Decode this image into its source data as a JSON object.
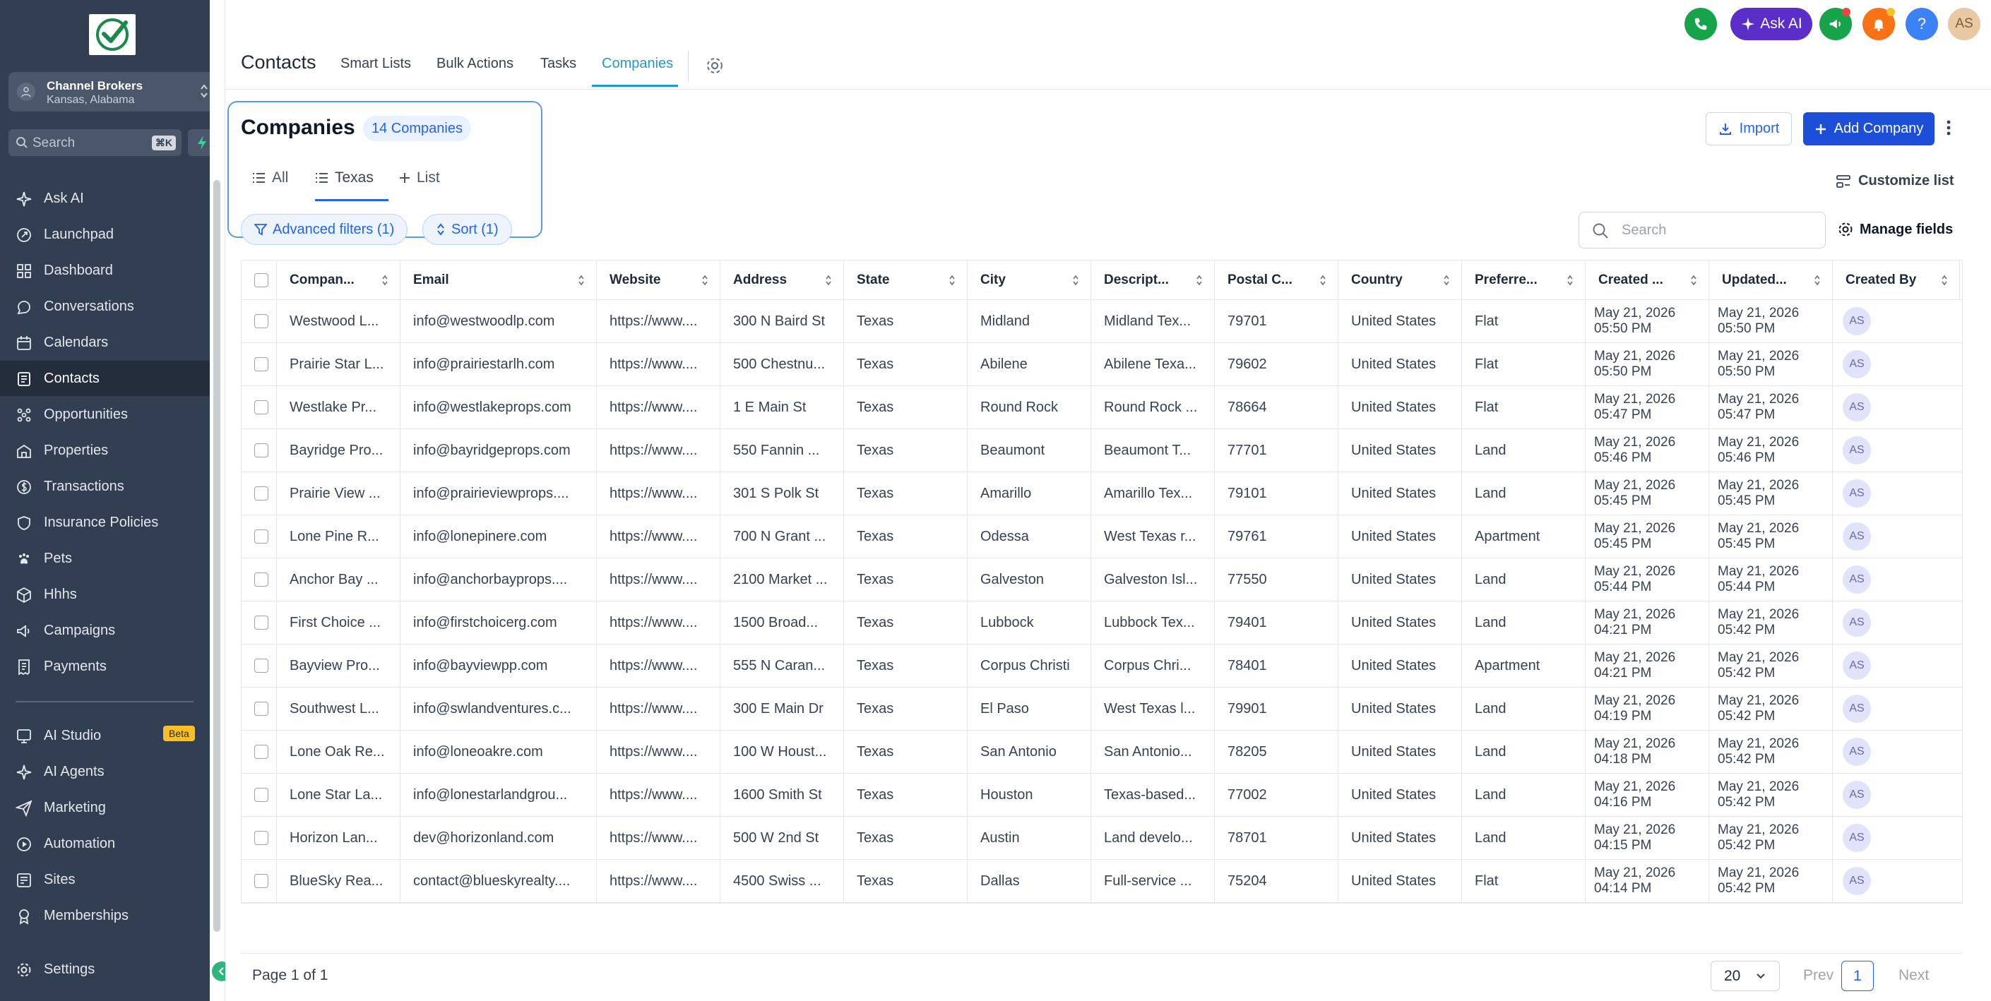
{
  "sidebar": {
    "account": {
      "name": "Channel Brokers",
      "location": "Kansas, Alabama"
    },
    "search": {
      "placeholder": "Search",
      "shortcut": "⌘K"
    },
    "items": [
      {
        "label": "Ask AI",
        "icon": "sparkle-icon"
      },
      {
        "label": "Launchpad",
        "icon": "rocket-icon"
      },
      {
        "label": "Dashboard",
        "icon": "grid-icon"
      },
      {
        "label": "Conversations",
        "icon": "chat-icon"
      },
      {
        "label": "Calendars",
        "icon": "calendar-icon"
      },
      {
        "label": "Contacts",
        "icon": "contacts-icon",
        "active": true
      },
      {
        "label": "Opportunities",
        "icon": "opportunities-icon"
      },
      {
        "label": "Properties",
        "icon": "building-icon"
      },
      {
        "label": "Transactions",
        "icon": "dollar-icon"
      },
      {
        "label": "Insurance Policies",
        "icon": "shield-icon"
      },
      {
        "label": "Pets",
        "icon": "paw-icon"
      },
      {
        "label": "Hhhs",
        "icon": "cube-icon"
      },
      {
        "label": "Campaigns",
        "icon": "megaphone-icon"
      },
      {
        "label": "Payments",
        "icon": "receipt-icon"
      }
    ],
    "items2": [
      {
        "label": "AI Studio",
        "icon": "studio-icon",
        "badge": "Beta"
      },
      {
        "label": "AI Agents",
        "icon": "sparkle-icon"
      },
      {
        "label": "Marketing",
        "icon": "send-icon"
      },
      {
        "label": "Automation",
        "icon": "automation-icon"
      },
      {
        "label": "Sites",
        "icon": "sites-icon"
      },
      {
        "label": "Memberships",
        "icon": "award-icon"
      }
    ],
    "settings": "Settings"
  },
  "topbar": {
    "title": "Contacts",
    "links": [
      "Smart Lists",
      "Bulk Actions",
      "Tasks",
      "Companies"
    ],
    "active": "Companies",
    "ask_ai": "Ask AI",
    "user_initials": "AS",
    "help": "?"
  },
  "page": {
    "heading": "Companies",
    "count_badge": "14 Companies",
    "views": [
      "All",
      "Texas",
      "List"
    ],
    "filters": {
      "advanced": "Advanced filters (1)",
      "sort": "Sort (1)"
    },
    "import": "Import",
    "add": "Add Company",
    "customize": "Customize list",
    "search_placeholder": "Search",
    "manage_fields": "Manage fields"
  },
  "table": {
    "headers": [
      "Compan...",
      "Email",
      "Website",
      "Address",
      "State",
      "City",
      "Descript...",
      "Postal C...",
      "Country",
      "Preferre...",
      "Created ...",
      "Updated...",
      "Created By"
    ],
    "rows": [
      [
        "Westwood L...",
        "info@westwoodlp.com",
        "https://www....",
        "300 N Baird St",
        "Texas",
        "Midland",
        "Midland Tex...",
        "79701",
        "United States",
        "Flat",
        [
          "May 21, 2026",
          "05:50 PM"
        ],
        [
          "May 21, 2026",
          "05:50 PM"
        ],
        "AS"
      ],
      [
        "Prairie Star L...",
        "info@prairiestarlh.com",
        "https://www....",
        "500 Chestnu...",
        "Texas",
        "Abilene",
        "Abilene Texa...",
        "79602",
        "United States",
        "Flat",
        [
          "May 21, 2026",
          "05:50 PM"
        ],
        [
          "May 21, 2026",
          "05:50 PM"
        ],
        "AS"
      ],
      [
        "Westlake Pr...",
        "info@westlakeprops.com",
        "https://www....",
        "1 E Main St",
        "Texas",
        "Round Rock",
        "Round Rock ...",
        "78664",
        "United States",
        "Flat",
        [
          "May 21, 2026",
          "05:47 PM"
        ],
        [
          "May 21, 2026",
          "05:47 PM"
        ],
        "AS"
      ],
      [
        "Bayridge Pro...",
        "info@bayridgeprops.com",
        "https://www....",
        "550 Fannin ...",
        "Texas",
        "Beaumont",
        "Beaumont T...",
        "77701",
        "United States",
        "Land",
        [
          "May 21, 2026",
          "05:46 PM"
        ],
        [
          "May 21, 2026",
          "05:46 PM"
        ],
        "AS"
      ],
      [
        "Prairie View ...",
        "info@prairieviewprops....",
        "https://www....",
        "301 S Polk St",
        "Texas",
        "Amarillo",
        "Amarillo Tex...",
        "79101",
        "United States",
        "Land",
        [
          "May 21, 2026",
          "05:45 PM"
        ],
        [
          "May 21, 2026",
          "05:45 PM"
        ],
        "AS"
      ],
      [
        "Lone Pine R...",
        "info@lonepinere.com",
        "https://www....",
        "700 N Grant ...",
        "Texas",
        "Odessa",
        "West Texas r...",
        "79761",
        "United States",
        "Apartment",
        [
          "May 21, 2026",
          "05:45 PM"
        ],
        [
          "May 21, 2026",
          "05:45 PM"
        ],
        "AS"
      ],
      [
        "Anchor Bay ...",
        "info@anchorbayprops....",
        "https://www....",
        "2100 Market ...",
        "Texas",
        "Galveston",
        "Galveston Isl...",
        "77550",
        "United States",
        "Land",
        [
          "May 21, 2026",
          "05:44 PM"
        ],
        [
          "May 21, 2026",
          "05:44 PM"
        ],
        "AS"
      ],
      [
        "First Choice ...",
        "info@firstchoicerg.com",
        "https://www....",
        "1500 Broad...",
        "Texas",
        "Lubbock",
        "Lubbock Tex...",
        "79401",
        "United States",
        "Land",
        [
          "May 21, 2026",
          "04:21 PM"
        ],
        [
          "May 21, 2026",
          "05:42 PM"
        ],
        "AS"
      ],
      [
        "Bayview Pro...",
        "info@bayviewpp.com",
        "https://www....",
        "555 N Caran...",
        "Texas",
        "Corpus Christi",
        "Corpus Chri...",
        "78401",
        "United States",
        "Apartment",
        [
          "May 21, 2026",
          "04:21 PM"
        ],
        [
          "May 21, 2026",
          "05:42 PM"
        ],
        "AS"
      ],
      [
        "Southwest L...",
        "info@swlandventures.c...",
        "https://www....",
        "300 E Main Dr",
        "Texas",
        "El Paso",
        "West Texas l...",
        "79901",
        "United States",
        "Land",
        [
          "May 21, 2026",
          "04:19 PM"
        ],
        [
          "May 21, 2026",
          "05:42 PM"
        ],
        "AS"
      ],
      [
        "Lone Oak Re...",
        "info@loneoakre.com",
        "https://www....",
        "100 W Houst...",
        "Texas",
        "San Antonio",
        "San Antonio...",
        "78205",
        "United States",
        "Land",
        [
          "May 21, 2026",
          "04:18 PM"
        ],
        [
          "May 21, 2026",
          "05:42 PM"
        ],
        "AS"
      ],
      [
        "Lone Star La...",
        "info@lonestarlandgrou...",
        "https://www....",
        "1600 Smith St",
        "Texas",
        "Houston",
        "Texas-based...",
        "77002",
        "United States",
        "Land",
        [
          "May 21, 2026",
          "04:16 PM"
        ],
        [
          "May 21, 2026",
          "05:42 PM"
        ],
        "AS"
      ],
      [
        "Horizon Lan...",
        "dev@horizonland.com",
        "https://www....",
        "500 W 2nd St",
        "Texas",
        "Austin",
        "Land develo...",
        "78701",
        "United States",
        "Land",
        [
          "May 21, 2026",
          "04:15 PM"
        ],
        [
          "May 21, 2026",
          "05:42 PM"
        ],
        "AS"
      ],
      [
        "BlueSky Rea...",
        "contact@blueskyrealty....",
        "https://www....",
        "4500 Swiss ...",
        "Texas",
        "Dallas",
        "Full-service ...",
        "75204",
        "United States",
        "Flat",
        [
          "May 21, 2026",
          "04:14 PM"
        ],
        [
          "May 21, 2026",
          "05:42 PM"
        ],
        "AS"
      ]
    ]
  },
  "pagination": {
    "text": "Page 1 of 1",
    "per_page": "20",
    "prev": "Prev",
    "current": "1",
    "next": "Next"
  },
  "colors": {
    "sidebar": "#323f52",
    "accent": "#2563eb",
    "active_tab": "#1d9bd1",
    "ask_ai": "#5b2fc7"
  }
}
